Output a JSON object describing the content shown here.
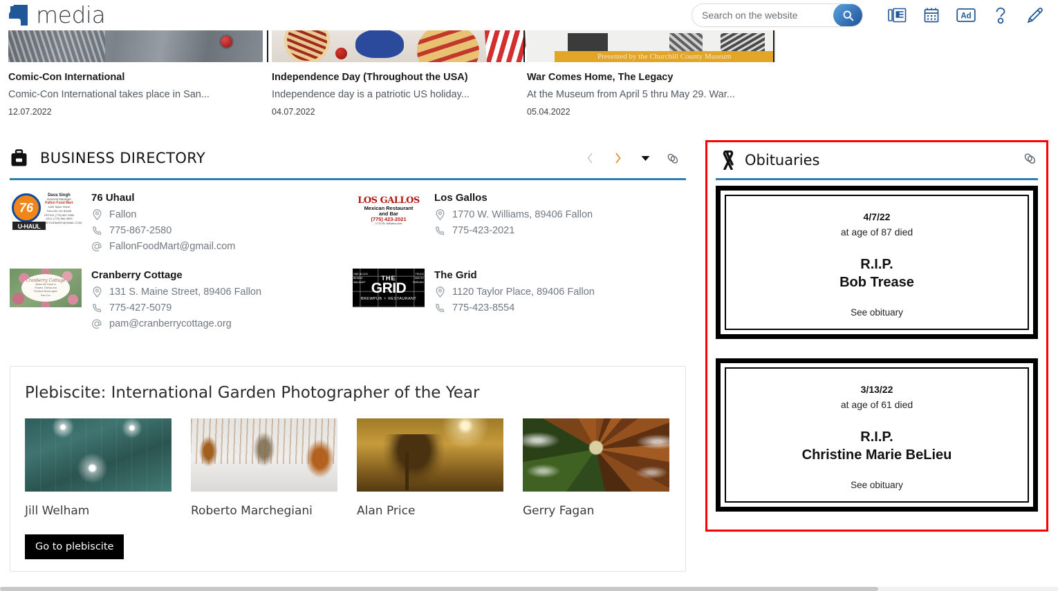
{
  "header": {
    "logo_text": "media",
    "logo_icon": "four-media-logo-icon",
    "search": {
      "placeholder": "Search on the website",
      "value": "",
      "button_icon": "search-icon"
    },
    "icons": [
      {
        "name": "newspaper-icon",
        "label": "Newspaper"
      },
      {
        "name": "calendar-icon",
        "label": "Calendar"
      },
      {
        "name": "ad-icon",
        "label": "Ad"
      },
      {
        "name": "help-icon",
        "label": "Help"
      },
      {
        "name": "pencil-icon",
        "label": "Edit"
      }
    ]
  },
  "news": {
    "cards": [
      {
        "title": "Comic-Con International",
        "desc": "Comic-Con International takes place in San...",
        "date": "12.07.2022",
        "image": "comic-con-convention-hall-photo"
      },
      {
        "title": "Independence Day (Throughout the USA)",
        "desc": "Independence day is a patriotic US holiday...",
        "date": "04.07.2022",
        "image": "july-4th-pie-hotdogs-flag-photo"
      },
      {
        "title": "War Comes Home, The Legacy",
        "desc": "At the Museum from April 5 thru May 29. War...",
        "date": "05.04.2022",
        "image": "museum-exhibit-poster",
        "image_caption": "Presented by the Churchill County Museum"
      }
    ]
  },
  "business_directory": {
    "title": "BUSINESS DIRECTORY",
    "icon": "briefcase-icon",
    "accent_color": "#2980b9",
    "controls": [
      {
        "name": "prev-button",
        "icon": "chevron-left-icon",
        "glyph": "‹",
        "state": "disabled"
      },
      {
        "name": "next-button",
        "icon": "chevron-right-icon",
        "glyph": "›",
        "state": "enabled"
      },
      {
        "name": "dropdown-button",
        "icon": "caret-down-icon",
        "glyph": "▼",
        "state": "enabled"
      },
      {
        "name": "permalink-button",
        "icon": "link-icon",
        "state": "enabled"
      }
    ],
    "items": [
      {
        "name": "76 Uhaul",
        "logo": "76-uhaul-fallon-food-mart-logo",
        "address": "Fallon",
        "phone": "775-867-2580",
        "email": "FallonFoodMart@gmail.com"
      },
      {
        "name": "Los Gallos",
        "logo": "los-gallos-mexican-restaurant-logo",
        "address": "1770 W. Williams, 89406 Fallon",
        "phone": "775-423-2021",
        "email": ""
      },
      {
        "name": "Cranberry Cottage",
        "logo": "cranberry-cottage-floral-logo",
        "address": "131 S. Maine Street, 89406 Fallon",
        "phone": "775-427-5079",
        "email": "pam@cranberrycottage.org"
      },
      {
        "name": "The Grid",
        "logo": "the-grid-brewpub-restaurant-logo",
        "address": "1120 Taylor Place, 89406 Fallon",
        "phone": "775-423-8554",
        "email": ""
      }
    ],
    "logo_76": {
      "ball_text": "76",
      "brand": "U-HAUL",
      "card_name": "Dava Singh",
      "card_role": "General Manager",
      "card_business": "Fallon Food Mart",
      "card_lines": "1180 Taylor Street\nFALLON, NV 89406\nOFFICE (775) 867-2580\nCELL (775) 560-9899\nFALLONFOODMART@GMAIL.COM"
    },
    "logo_gallos": {
      "l1": "LOS GALLOS",
      "l2": "Mexican Restaurant",
      "l3": "and Bar",
      "l4": "(775) 423-2021",
      "l5": "1770 W. Williams Ave"
    },
    "logo_cranberry": {
      "script": "Cranberry Cottage",
      "sub": "Where the Finest in\nFlowers, Fabrics and\nFurniture Bloom again\nPam Cox"
    },
    "logo_grid": {
      "the": "THE",
      "grid": "GRID",
      "tag": "BREWPUB ✧ RESTAURANT",
      "left": "ONE BLOCK\nBEHIND\nWALMART",
      "right": "TRUCK\nAND RV\nPARKING"
    }
  },
  "plebiscite": {
    "title": "Plebiscite: International Garden Photographer of the Year",
    "button_label": "Go to plebiscite",
    "entries": [
      {
        "author": "Jill Welham",
        "image": "teal-dandelion-abstract-photo"
      },
      {
        "author": "Roberto Marchegiani",
        "image": "misty-swamp-cypress-trees-photo"
      },
      {
        "author": "Alan Price",
        "image": "sepia-oak-tree-sunrise-photo"
      },
      {
        "author": "Gerry Fagan",
        "image": "dandelion-seedhead-macro-photo"
      }
    ]
  },
  "obituaries": {
    "title": "Obituaries",
    "icon": "mourning-ribbon-icon",
    "permalink_icon": "link-icon",
    "highlight_color": "#ff0000",
    "accent_color": "#2980b9",
    "entries": [
      {
        "date": "4/7/22",
        "age_text": "at age of 87 died",
        "rip": "R.I.P.",
        "name": "Bob Trease",
        "link_label": "See obituary"
      },
      {
        "date": "3/13/22",
        "age_text": "at age of 61 died",
        "rip": "R.I.P.",
        "name": "Christine Marie BeLieu",
        "link_label": "See obituary"
      }
    ]
  }
}
